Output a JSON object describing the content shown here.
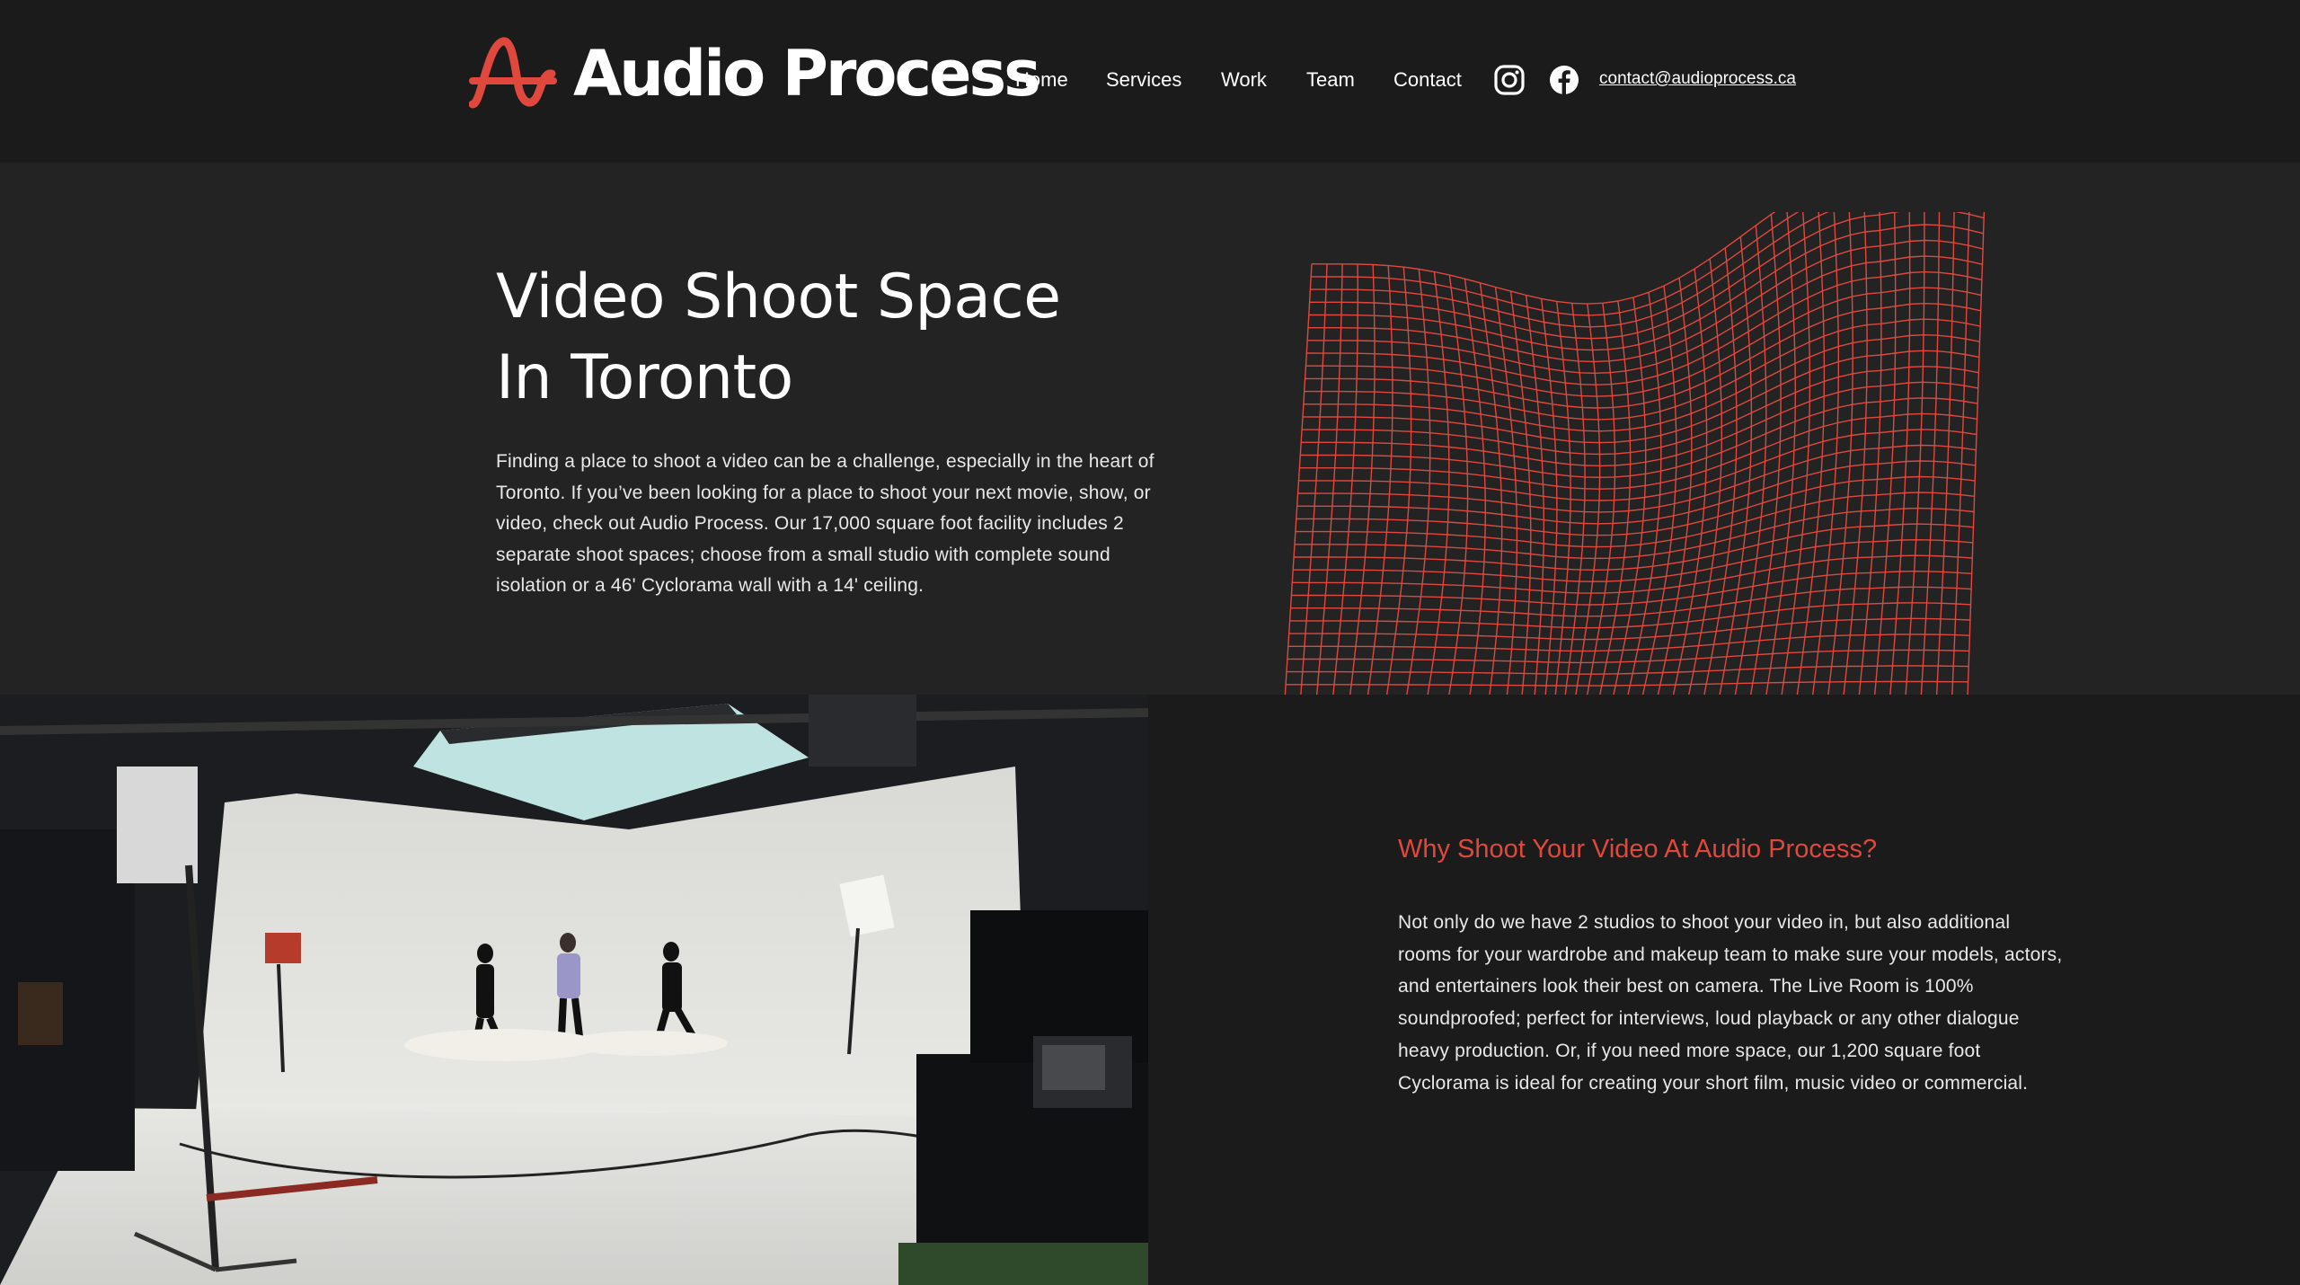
{
  "brand": {
    "name": "Audio Process",
    "accent_color": "#e0483e",
    "logo_icon": "waveform-logo-icon"
  },
  "nav": {
    "items": [
      {
        "label": "Home"
      },
      {
        "label": "Services"
      },
      {
        "label": "Work"
      },
      {
        "label": "Team"
      },
      {
        "label": "Contact"
      }
    ],
    "social": [
      {
        "icon": "instagram-icon"
      },
      {
        "icon": "facebook-icon"
      }
    ],
    "email": "contact@audioprocess.ca"
  },
  "hero": {
    "title_line1": "Video Shoot Space",
    "title_line2": "In Toronto",
    "body": "Finding a place to shoot a video can be a challenge, especially in the heart of Toronto. If you’ve been looking for a place to shoot your next movie, show, or video, check out Audio Process. Our 17,000 square foot facility includes 2 separate shoot spaces; choose from a small studio with complete sound isolation or a 46' Cyclorama wall with a 14' ceiling."
  },
  "why": {
    "title": "Why Shoot Your Video At Audio Process?",
    "body": "Not only do we have 2 studios to shoot your video in, but also additional rooms for your wardrobe and makeup team to make sure your models, actors, and entertainers look their best on camera. The Live Room is 100% soundproofed; perfect for interviews, loud playback or any other dialogue heavy production. Or, if you need more space, our 1,200 square foot Cyclorama is ideal for creating your short film, music video or commercial."
  }
}
